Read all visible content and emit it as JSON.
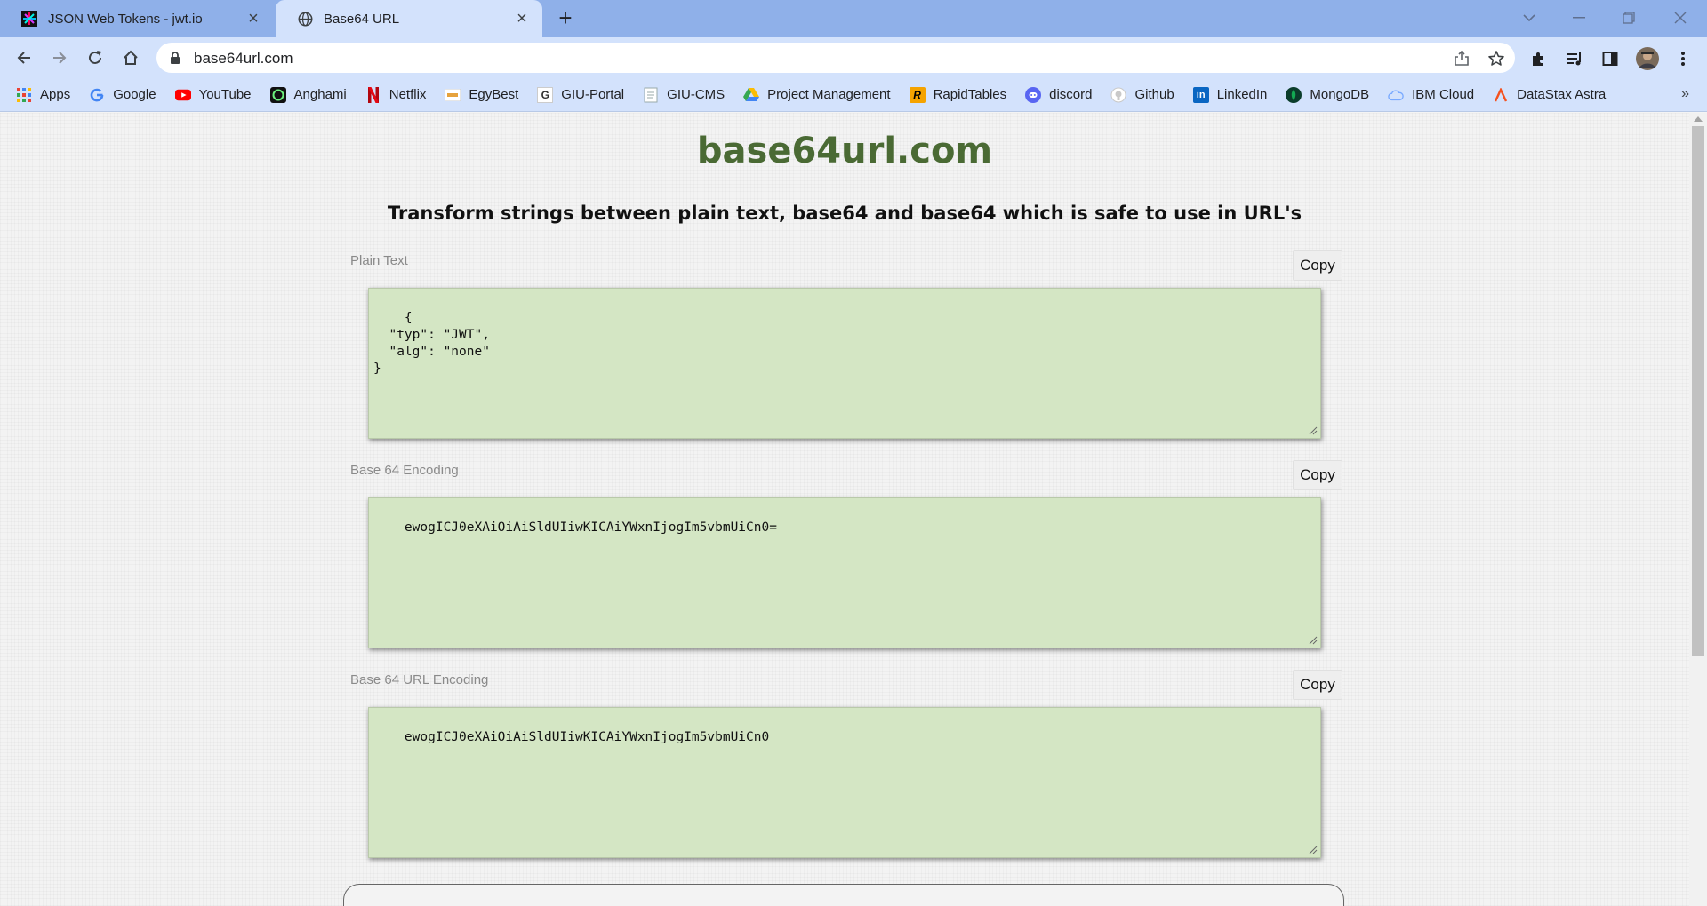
{
  "browser": {
    "tabs": [
      {
        "title": "JSON Web Tokens - jwt.io",
        "active": false
      },
      {
        "title": "Base64 URL",
        "active": true
      }
    ],
    "address": "base64url.com",
    "bookmarks": [
      {
        "label": "Apps",
        "icon": "apps-grid-icon"
      },
      {
        "label": "Google",
        "icon": "google-icon"
      },
      {
        "label": "YouTube",
        "icon": "youtube-icon"
      },
      {
        "label": "Anghami",
        "icon": "anghami-icon"
      },
      {
        "label": "Netflix",
        "icon": "netflix-icon"
      },
      {
        "label": "EgyBest",
        "icon": "egybest-icon"
      },
      {
        "label": "GIU-Portal",
        "icon": "giu-portal-icon"
      },
      {
        "label": "GIU-CMS",
        "icon": "giu-cms-icon"
      },
      {
        "label": "Project Management",
        "icon": "google-drive-icon"
      },
      {
        "label": "RapidTables",
        "icon": "rapidtables-icon"
      },
      {
        "label": "discord",
        "icon": "discord-icon"
      },
      {
        "label": "Github",
        "icon": "github-icon"
      },
      {
        "label": "LinkedIn",
        "icon": "linkedin-icon"
      },
      {
        "label": "MongoDB",
        "icon": "mongodb-icon"
      },
      {
        "label": "IBM Cloud",
        "icon": "ibm-cloud-icon"
      },
      {
        "label": "DataStax Astra",
        "icon": "datastax-icon"
      }
    ],
    "more_bookmarks": "»"
  },
  "page": {
    "title": "base64url.com",
    "subtitle": "Transform strings between plain text, base64 and base64 which is safe to use in URL's",
    "fields": [
      {
        "label": "Plain Text",
        "copy_label": "Copy",
        "value": "{\n  \"typ\": \"JWT\",\n  \"alg\": \"none\"\n}"
      },
      {
        "label": "Base 64 Encoding",
        "copy_label": "Copy",
        "value": "ewogICJ0eXAiOiAiSldUIiwKICAiYWxnIjogIm5vbmUiCn0="
      },
      {
        "label": "Base 64 URL Encoding",
        "copy_label": "Copy",
        "value": "ewogICJ0eXAiOiAiSldUIiwKICAiYWxnIjogIm5vbmUiCn0"
      }
    ]
  },
  "colors": {
    "title_green": "#4a6a34",
    "textarea_bg": "#d4e6c4",
    "tabstrip": "#8fb0e9",
    "toolbar": "#d3e2fc",
    "grammarly": "#15c39a"
  }
}
